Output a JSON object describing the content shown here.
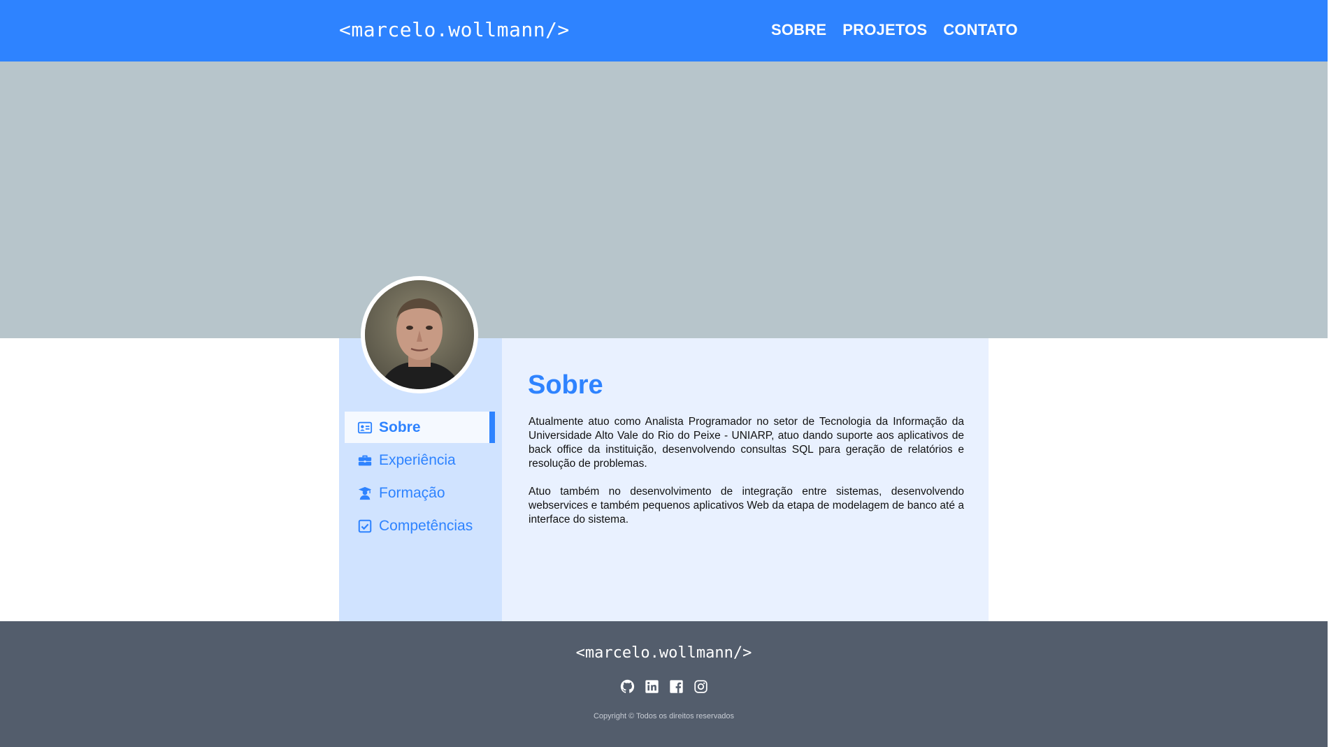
{
  "header": {
    "logo": "<marcelo.wollmann/>",
    "nav": [
      {
        "label": "SOBRE"
      },
      {
        "label": "PROJETOS"
      },
      {
        "label": "CONTATO"
      }
    ]
  },
  "sidebar": {
    "items": [
      {
        "label": "Sobre",
        "icon": "id-card-icon",
        "active": true
      },
      {
        "label": "Experiência",
        "icon": "briefcase-icon",
        "active": false
      },
      {
        "label": "Formação",
        "icon": "graduate-icon",
        "active": false
      },
      {
        "label": "Competências",
        "icon": "checkbox-icon",
        "active": false
      }
    ]
  },
  "main": {
    "title": "Sobre",
    "paragraphs": [
      "Atualmente atuo como Analista Programador no setor de Tecnologia da Informação da Universidade Alto Vale do Rio do Peixe - UNIARP, atuo dando suporte aos aplicativos de back office da instituição, desenvolvendo consultas SQL para geração de relatórios e resolução de problemas.",
      "Atuo também no desenvolvimento de integração entre sistemas, desenvolvendo webservices e também pequenos aplicativos Web da etapa de modelagem de banco até a interface do sistema."
    ]
  },
  "footer": {
    "logo": "<marcelo.wollmann/>",
    "socials": [
      "github-icon",
      "linkedin-icon",
      "facebook-icon",
      "instagram-icon"
    ],
    "copyright": "Copyright © Todos os direitos reservados"
  },
  "colors": {
    "primary": "#2e83ff",
    "banner": "#b7c5cb",
    "sidebar_bg": "#d0e3ff",
    "content_bg": "#e9f1ff",
    "footer_bg": "#535d6c"
  }
}
